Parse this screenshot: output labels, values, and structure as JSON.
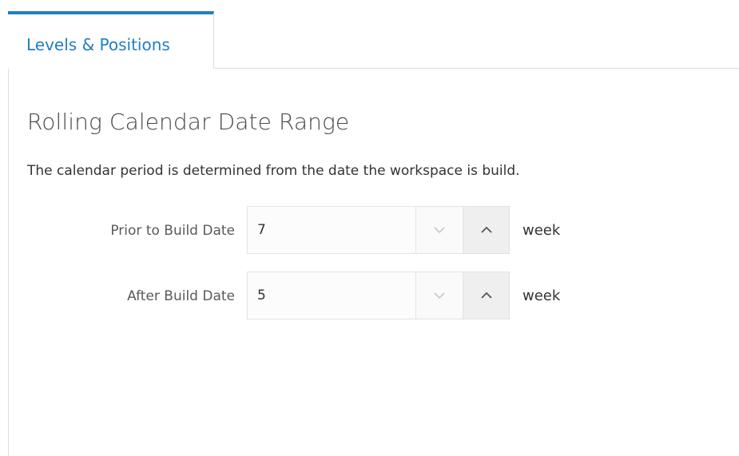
{
  "tabs": [
    {
      "label": "Levels & Positions",
      "active": true
    }
  ],
  "section": {
    "title": "Rolling Calendar Date Range",
    "description": "The calendar period is determined from the date the workspace is build."
  },
  "fields": {
    "prior": {
      "label": "Prior to Build Date",
      "value": "7",
      "unit": "week"
    },
    "after": {
      "label": "After Build Date",
      "value": "5",
      "unit": "week"
    }
  },
  "icons": {
    "decrement": "chevron-down-icon",
    "increment": "chevron-up-icon"
  },
  "colors": {
    "accent": "#1f7ec1",
    "border": "#dcdcdc",
    "text": "#333333"
  }
}
